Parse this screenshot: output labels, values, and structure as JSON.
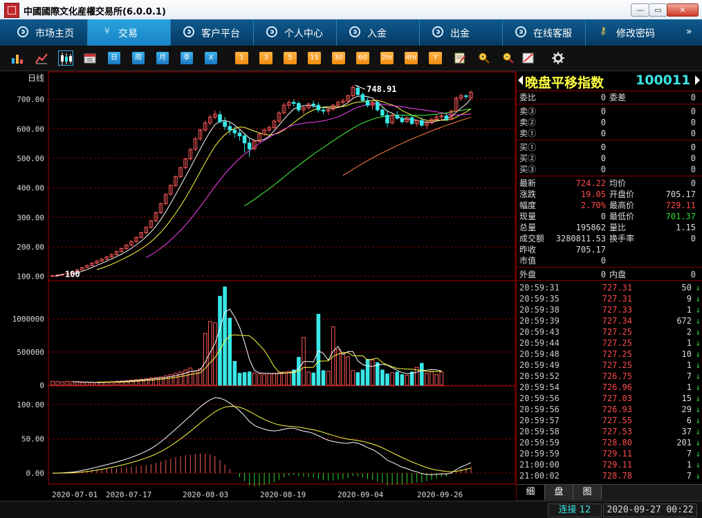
{
  "window": {
    "title": "中國國際文化産權交易所(6.0.0.1)",
    "min": "—",
    "max": "▭",
    "close": "✕"
  },
  "nav": {
    "items": [
      {
        "label": "市场主页",
        "active": false
      },
      {
        "label": "交易",
        "active": true
      },
      {
        "label": "客户平台",
        "active": false
      },
      {
        "label": "个人中心",
        "active": false
      },
      {
        "label": "入金",
        "active": false
      },
      {
        "label": "出金",
        "active": false
      },
      {
        "label": "在线客服",
        "active": false
      },
      {
        "label": "修改密码",
        "active": false
      }
    ],
    "more": "»"
  },
  "toolbar": {
    "period_buttons": [
      "日",
      "周",
      "月",
      "季",
      "X"
    ],
    "minute_buttons": [
      "1",
      "3",
      "5",
      "15",
      "30",
      "60",
      "2hr",
      "4hr",
      "Y"
    ]
  },
  "chart_data": [
    {
      "type": "candlestick",
      "title": "日线",
      "annotations": [
        {
          "text": "748.91",
          "type": "max"
        },
        {
          "text": "100",
          "type": "start"
        }
      ],
      "y_ticks": [
        "700.00",
        "600.00",
        "500.00",
        "400.00",
        "300.00",
        "200.00",
        "100.00"
      ],
      "ylim": [
        85,
        760
      ],
      "ohlc": [
        [
          100,
          104,
          99,
          103
        ],
        [
          103,
          106,
          101,
          105
        ],
        [
          105,
          108,
          103,
          107
        ],
        [
          107,
          112,
          105,
          110
        ],
        [
          110,
          118,
          108,
          116
        ],
        [
          116,
          125,
          114,
          122
        ],
        [
          122,
          132,
          120,
          130
        ],
        [
          130,
          140,
          128,
          137
        ],
        [
          137,
          148,
          134,
          145
        ],
        [
          145,
          156,
          141,
          152
        ],
        [
          152,
          162,
          148,
          158
        ],
        [
          158,
          170,
          154,
          166
        ],
        [
          166,
          178,
          162,
          174
        ],
        [
          174,
          188,
          170,
          184
        ],
        [
          184,
          198,
          180,
          194
        ],
        [
          194,
          210,
          190,
          206
        ],
        [
          206,
          222,
          202,
          218
        ],
        [
          218,
          236,
          214,
          232
        ],
        [
          232,
          252,
          228,
          248
        ],
        [
          248,
          270,
          244,
          266
        ],
        [
          266,
          292,
          262,
          288
        ],
        [
          288,
          320,
          284,
          316
        ],
        [
          316,
          350,
          312,
          346
        ],
        [
          346,
          382,
          342,
          378
        ],
        [
          378,
          412,
          374,
          408
        ],
        [
          408,
          442,
          404,
          438
        ],
        [
          438,
          472,
          434,
          468
        ],
        [
          468,
          502,
          464,
          498
        ],
        [
          498,
          535,
          494,
          530
        ],
        [
          530,
          572,
          526,
          566
        ],
        [
          566,
          600,
          560,
          596
        ],
        [
          596,
          628,
          590,
          620
        ],
        [
          620,
          648,
          612,
          640
        ],
        [
          640,
          662,
          632,
          650
        ],
        [
          648,
          660,
          618,
          624
        ],
        [
          624,
          640,
          596,
          608
        ],
        [
          608,
          622,
          580,
          596
        ],
        [
          596,
          608,
          570,
          586
        ],
        [
          586,
          600,
          560,
          576
        ],
        [
          576,
          582,
          520,
          552
        ],
        [
          552,
          568,
          505,
          532
        ],
        [
          532,
          562,
          528,
          558
        ],
        [
          558,
          586,
          554,
          582
        ],
        [
          582,
          602,
          576,
          596
        ],
        [
          596,
          612,
          588,
          604
        ],
        [
          604,
          632,
          600,
          626
        ],
        [
          626,
          660,
          620,
          654
        ],
        [
          654,
          688,
          650,
          680
        ],
        [
          680,
          696,
          668,
          690
        ],
        [
          690,
          700,
          676,
          686
        ],
        [
          686,
          694,
          656,
          664
        ],
        [
          664,
          676,
          650,
          672
        ],
        [
          672,
          690,
          664,
          684
        ],
        [
          684,
          696,
          670,
          680
        ],
        [
          680,
          690,
          654,
          664
        ],
        [
          664,
          674,
          650,
          660
        ],
        [
          660,
          672,
          648,
          666
        ],
        [
          666,
          684,
          660,
          680
        ],
        [
          680,
          696,
          672,
          690
        ],
        [
          690,
          702,
          680,
          694
        ],
        [
          694,
          716,
          686,
          712
        ],
        [
          712,
          748,
          706,
          740
        ],
        [
          738,
          748,
          712,
          716
        ],
        [
          716,
          724,
          690,
          696
        ],
        [
          696,
          706,
          672,
          680
        ],
        [
          680,
          694,
          664,
          690
        ],
        [
          690,
          694,
          658,
          664
        ],
        [
          664,
          672,
          640,
          646
        ],
        [
          646,
          664,
          606,
          620
        ],
        [
          620,
          652,
          616,
          646
        ],
        [
          646,
          660,
          630,
          636
        ],
        [
          636,
          648,
          618,
          624
        ],
        [
          624,
          642,
          620,
          638
        ],
        [
          638,
          646,
          612,
          618
        ],
        [
          618,
          632,
          608,
          628
        ],
        [
          628,
          640,
          606,
          612
        ],
        [
          612,
          626,
          600,
          620
        ],
        [
          620,
          636,
          616,
          632
        ],
        [
          632,
          648,
          624,
          640
        ],
        [
          640,
          652,
          628,
          644
        ],
        [
          644,
          652,
          626,
          632
        ],
        [
          632,
          666,
          628,
          660
        ],
        [
          660,
          710,
          656,
          704
        ],
        [
          704,
          720,
          694,
          712
        ],
        [
          712,
          716,
          700,
          710
        ],
        [
          705,
          730,
          701,
          724
        ]
      ],
      "ma_ylim": "same"
    },
    {
      "type": "bar",
      "title": "volume",
      "y_ticks": [
        "1000000",
        "500000",
        "0"
      ],
      "ylim": [
        0,
        1500000
      ],
      "values": [
        60000,
        55000,
        50000,
        58000,
        52000,
        45000,
        40000,
        42000,
        38000,
        40000,
        48000,
        52000,
        55000,
        60000,
        64000,
        70000,
        78000,
        85000,
        92000,
        98000,
        110000,
        118000,
        125000,
        140000,
        160000,
        180000,
        200000,
        230000,
        260000,
        210000,
        250000,
        780000,
        960000,
        940000,
        1340000,
        1480000,
        1010000,
        360000,
        180000,
        190000,
        200000,
        185000,
        170000,
        160000,
        175000,
        180000,
        190000,
        200000,
        210000,
        230000,
        420000,
        720000,
        200000,
        185000,
        1070000,
        220000,
        210000,
        880000,
        540000,
        470000,
        430000,
        220000,
        190000,
        230000,
        390000,
        380000,
        340000,
        230000,
        170000,
        190000,
        200000,
        160000,
        150000,
        200000,
        270000,
        330000,
        180000,
        210000,
        160000,
        200000
      ],
      "colors_up_down": "mixed"
    },
    {
      "type": "line",
      "title": "oscillator",
      "y_ticks": [
        "100.00",
        "50.00",
        "0.00"
      ],
      "ylim": [
        -15,
        120
      ],
      "x_ticks": [
        "2020-07-01",
        "2020-07-17",
        "2020-08-03",
        "2020-08-19",
        "2020-09-04",
        "2020-09-26"
      ]
    }
  ],
  "quote": {
    "index_name": "晚盘平移指数",
    "index_code": "100011",
    "order_rows": [
      {
        "a": "委比",
        "b": "0",
        "c": "委差",
        "d": "0"
      }
    ],
    "sell_rows": [
      {
        "a": "卖③",
        "b": "0",
        "d": "0"
      },
      {
        "a": "卖②",
        "b": "0",
        "d": "0"
      },
      {
        "a": "卖①",
        "b": "0",
        "d": "0"
      }
    ],
    "buy_rows": [
      {
        "a": "买①",
        "b": "0",
        "d": "0"
      },
      {
        "a": "买②",
        "b": "0",
        "d": "0"
      },
      {
        "a": "买③",
        "b": "0",
        "d": "0"
      }
    ],
    "detail_rows": [
      {
        "a": "最新",
        "b": "724.22",
        "bc": "red",
        "c": "均价",
        "d": "0",
        "dc": "white"
      },
      {
        "a": "涨跌",
        "b": "19.05",
        "bc": "red",
        "c": "开盘价",
        "d": "705.17",
        "dc": "white"
      },
      {
        "a": "幅度",
        "b": "2.70%",
        "bc": "red",
        "c": "最高价",
        "d": "729.11",
        "dc": "red"
      },
      {
        "a": "现量",
        "b": "0",
        "bc": "white",
        "c": "最低价",
        "d": "701.37",
        "dc": "green"
      },
      {
        "a": "总量",
        "b": "195862",
        "bc": "white",
        "c": "量比",
        "d": "1.15",
        "dc": "white"
      },
      {
        "a": "成交额",
        "b": "3280811.53",
        "bc": "white",
        "c": "换手率",
        "d": "0",
        "dc": "white"
      },
      {
        "a": "昨收",
        "b": "705.17",
        "bc": "white",
        "c": "",
        "d": "",
        "dc": "white"
      },
      {
        "a": "市值",
        "b": "0",
        "bc": "white",
        "c": "",
        "d": "",
        "dc": "white"
      }
    ],
    "outer_row": {
      "a": "外盘",
      "b": "0",
      "c": "内盘",
      "d": "0"
    },
    "ticks": [
      {
        "time": "20:59:31",
        "price": "727.31",
        "vol": "50"
      },
      {
        "time": "20:59:35",
        "price": "727.31",
        "vol": "9"
      },
      {
        "time": "20:59:38",
        "price": "727.33",
        "vol": "1"
      },
      {
        "time": "20:59:39",
        "price": "727.34",
        "vol": "672"
      },
      {
        "time": "20:59:43",
        "price": "727.25",
        "vol": "2"
      },
      {
        "time": "20:59:44",
        "price": "727.25",
        "vol": "1"
      },
      {
        "time": "20:59:48",
        "price": "727.25",
        "vol": "10"
      },
      {
        "time": "20:59:49",
        "price": "727.25",
        "vol": "1"
      },
      {
        "time": "20:59:52",
        "price": "726.75",
        "vol": "7"
      },
      {
        "time": "20:59:54",
        "price": "726.96",
        "vol": "1"
      },
      {
        "time": "20:59:56",
        "price": "727.03",
        "vol": "15"
      },
      {
        "time": "20:59:56",
        "price": "726.93",
        "vol": "29"
      },
      {
        "time": "20:59:57",
        "price": "727.55",
        "vol": "6"
      },
      {
        "time": "20:59:58",
        "price": "727.53",
        "vol": "37"
      },
      {
        "time": "20:59:59",
        "price": "728.80",
        "vol": "201"
      },
      {
        "time": "20:59:59",
        "price": "729.11",
        "vol": "7"
      },
      {
        "time": "21:00:00",
        "price": "729.11",
        "vol": "1"
      },
      {
        "time": "21:00:02",
        "price": "728.78",
        "vol": "7"
      }
    ],
    "tick_arrow": "↓",
    "tabs": [
      "细",
      "盘",
      "图"
    ]
  },
  "status": {
    "connection": "连接 12",
    "datetime": "2020-09-27 00:22"
  },
  "colors": {
    "up": "#ff5a5a",
    "down": "#39e6e6",
    "grid": "#8b0000",
    "green": "#2fdc2f"
  }
}
